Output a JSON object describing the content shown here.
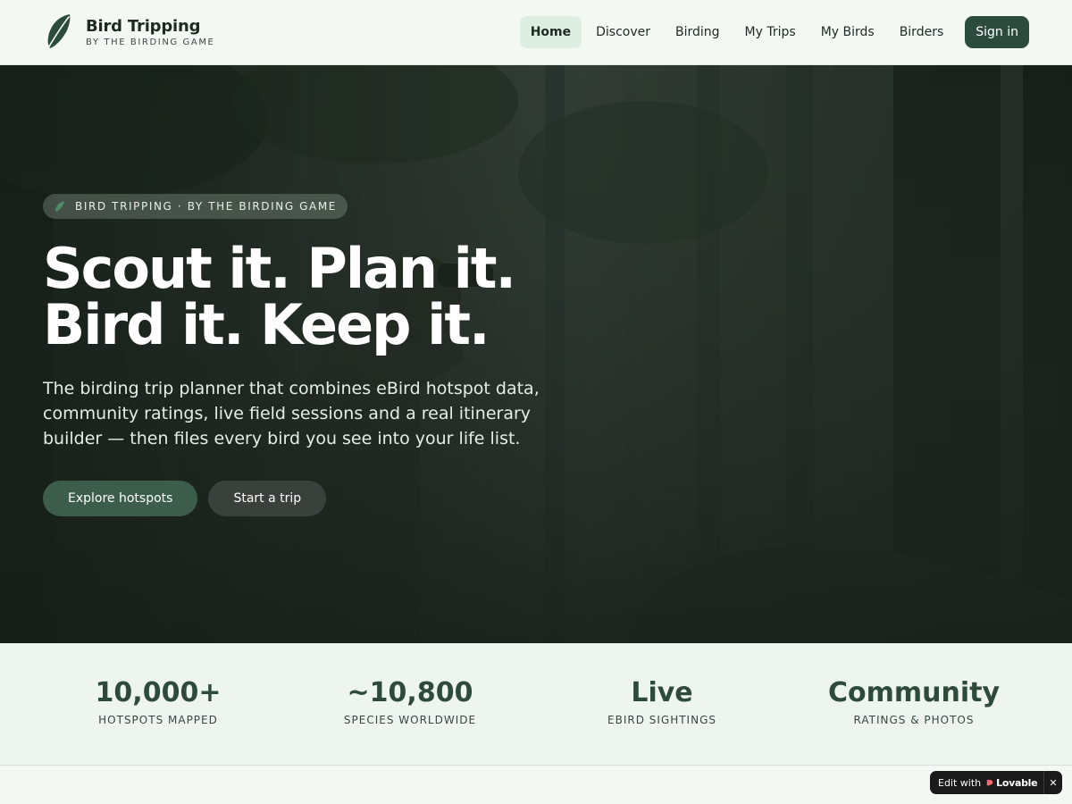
{
  "brand": {
    "title": "Bird Tripping",
    "subtitle": "BY THE BIRDING GAME",
    "logo_icon": "feather-icon"
  },
  "nav": {
    "links": [
      {
        "label": "Home",
        "active": true
      },
      {
        "label": "Discover",
        "active": false
      },
      {
        "label": "Birding",
        "active": false
      },
      {
        "label": "My Trips",
        "active": false
      },
      {
        "label": "My Birds",
        "active": false
      },
      {
        "label": "Birders",
        "active": false
      }
    ],
    "signin_label": "Sign in"
  },
  "hero": {
    "badge_icon": "feather-icon",
    "badge_text": "BIRD TRIPPING · BY THE BIRDING GAME",
    "headline_line1": "Scout it. Plan it.",
    "headline_line2": "Bird it. Keep it.",
    "lede": "The birding trip planner that combines eBird hotspot data, community ratings, live field sessions and a real itinerary builder — then files every bird you see into your life list.",
    "primary_cta": "Explore hotspots",
    "secondary_cta": "Start a trip"
  },
  "stats": [
    {
      "value": "10,000+",
      "label": "HOTSPOTS MAPPED"
    },
    {
      "value": "~10,800",
      "label": "SPECIES WORLDWIDE"
    },
    {
      "value": "Live",
      "label": "EBIRD SIGHTINGS"
    },
    {
      "value": "Community",
      "label": "RATINGS & PHOTOS"
    }
  ],
  "edit_badge": {
    "prefix": "Edit with",
    "brand": "Lovable",
    "close": "✕",
    "heart_icon": "lovable-heart-icon"
  },
  "colors": {
    "accent": "#2d4b3d",
    "nav_active_bg": "#dfeee2",
    "page_bg": "#f3f8f3",
    "stats_bg": "#edf5ee",
    "stat_value": "#2e4a3b"
  }
}
